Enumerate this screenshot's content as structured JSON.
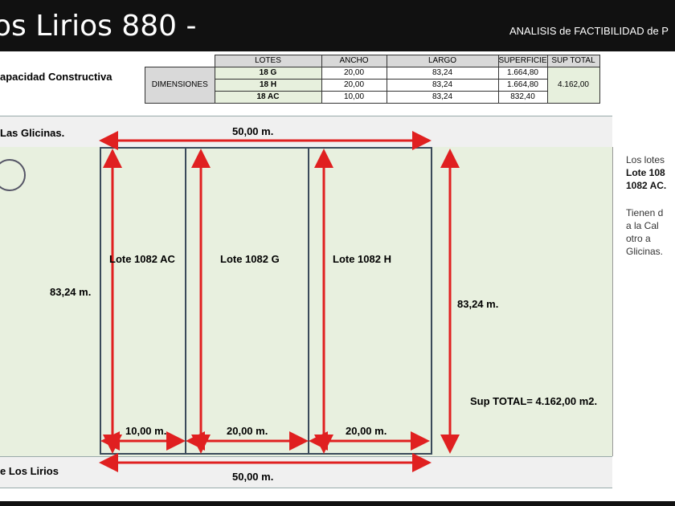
{
  "header": {
    "title": "os Lirios 880 -",
    "subtitle": "ANALISIS de FACTIBILIDAD de P"
  },
  "section_title": "apacidad Constructiva",
  "table": {
    "label": "DIMENSIONES",
    "headers": [
      "LOTES",
      "ANCHO",
      "LARGO",
      "SUPERFICIE",
      "SUP TOTAL"
    ],
    "rows": [
      [
        "18 G",
        "20,00",
        "83,24",
        "1.664,80"
      ],
      [
        "18 H",
        "20,00",
        "83,24",
        "1.664,80"
      ],
      [
        "18 AC",
        "10,00",
        "83,24",
        "832,40"
      ]
    ],
    "sup_total": "4.162,00"
  },
  "plan": {
    "street_top": "Las Glicinas.",
    "street_bottom": "e Los Lirios",
    "top_width": "50,00 m.",
    "bottom_width": "50,00 m.",
    "left_length": "83,24 m.",
    "right_length": "83,24 m.",
    "lots": [
      {
        "name": "Lote 1082 AC",
        "width": "10,00 m."
      },
      {
        "name": "Lote 1082 G",
        "width": "20,00 m."
      },
      {
        "name": "Lote 1082 H",
        "width": "20,00 m."
      }
    ],
    "sup_total": "Sup TOTAL= 4.162,00 m2."
  },
  "sidebar": {
    "line1": "Los lotes",
    "line2": "Lote 108",
    "line3": "1082 AC.",
    "line4": "Tienen d",
    "line5": "a la Cal",
    "line6": "otro a",
    "line7": "Glicinas."
  },
  "colors": {
    "arrow": "#e02020",
    "lot_fill": "#e8f0df",
    "header_bg": "#111111"
  }
}
